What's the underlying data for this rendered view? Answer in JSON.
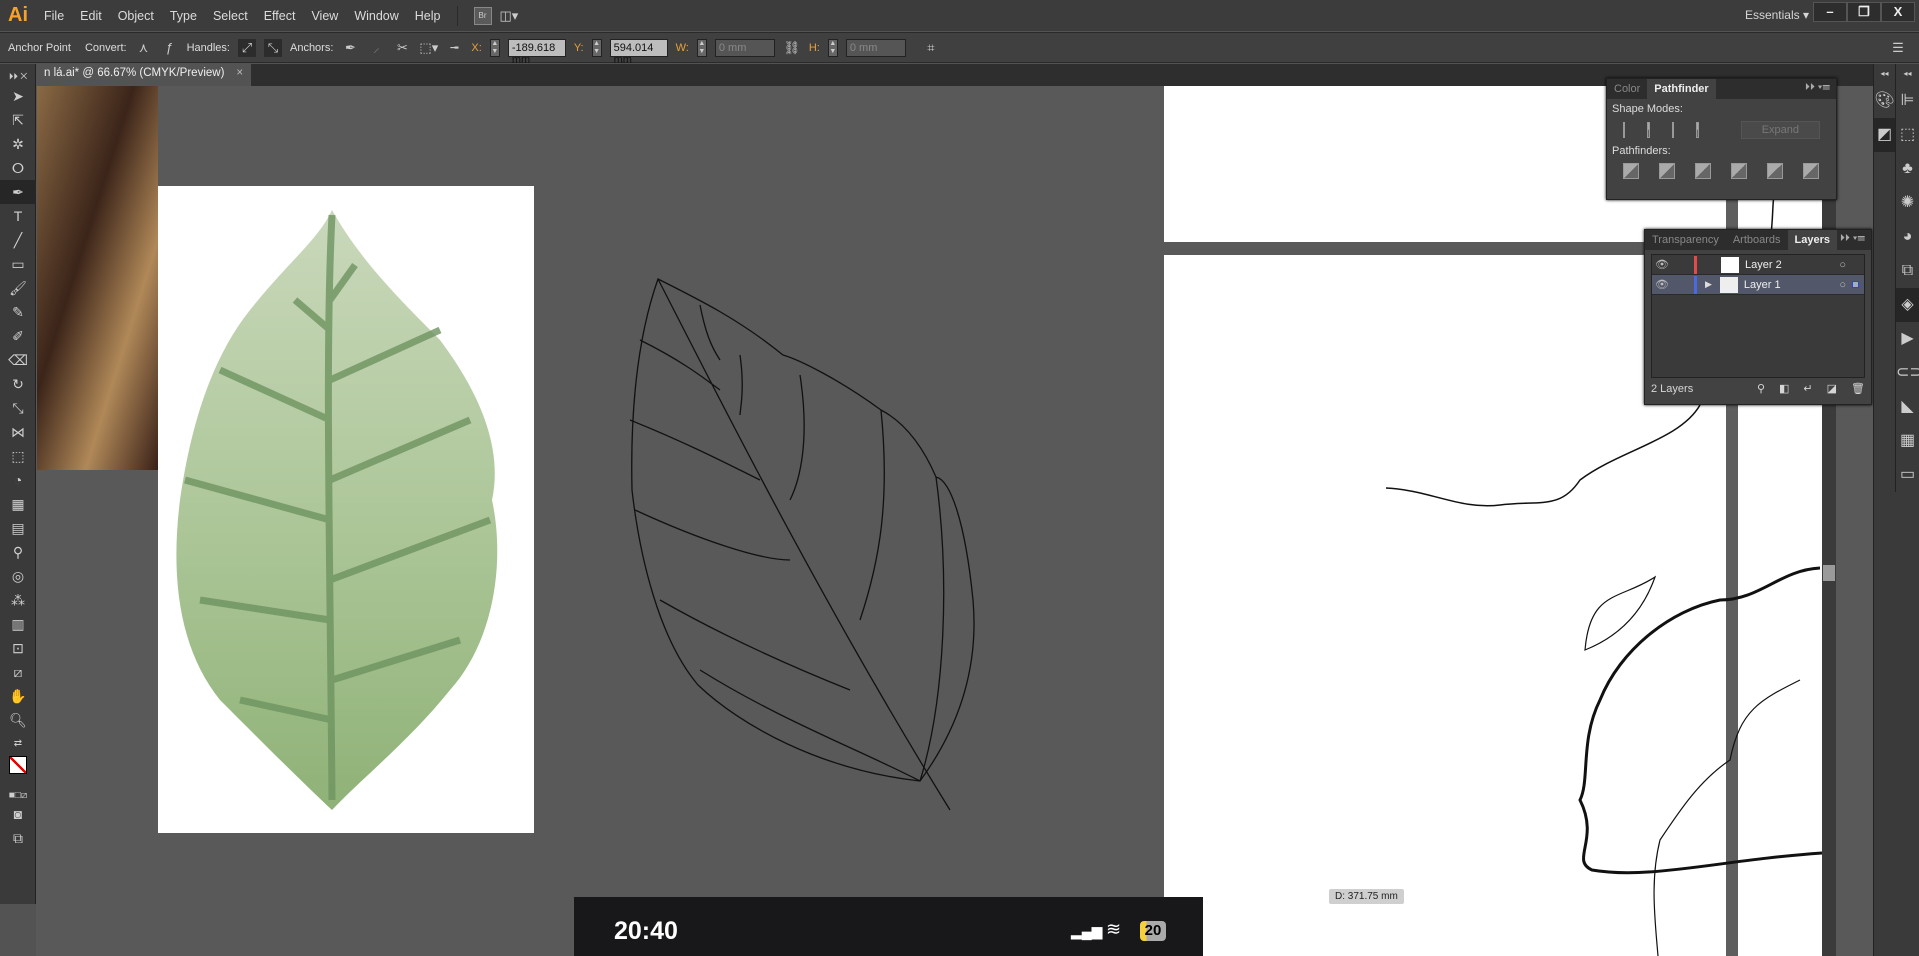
{
  "app": {
    "logo": "Ai",
    "menu": [
      "File",
      "Edit",
      "Object",
      "Type",
      "Select",
      "Effect",
      "View",
      "Window",
      "Help"
    ],
    "bridge": "Br",
    "workspace": "Essentials",
    "window_buttons": [
      "–",
      "❐",
      "X"
    ]
  },
  "control": {
    "tool_name": "Anchor Point",
    "convert": "Convert:",
    "handles": "Handles:",
    "anchors": "Anchors:",
    "x_label": "X:",
    "x_value": "-189.618 mm",
    "y_label": "Y:",
    "y_value": "594.014 mm",
    "w_label": "W:",
    "w_value": "0 mm",
    "h_label": "H:",
    "h_value": "0 mm"
  },
  "document": {
    "tab": "n lá.ai* @ 66.67% (CMYK/Preview)",
    "close": "×"
  },
  "pathfinder": {
    "tabs": [
      "Color",
      "Pathfinder"
    ],
    "shape_modes": "Shape Modes:",
    "expand": "Expand",
    "pathfinders": "Pathfinders:"
  },
  "layers": {
    "tabs": [
      "Transparency",
      "Artboards",
      "Layers"
    ],
    "items": [
      {
        "name": "Layer 2",
        "color": "#e34a4a"
      },
      {
        "name": "Layer 1",
        "color": "#4a6ae3",
        "selected": true
      }
    ],
    "count": "2 Layers"
  },
  "measure": {
    "distance": "D: 371.75 mm"
  },
  "phone_status": {
    "time": "20:40",
    "battery": "20"
  }
}
